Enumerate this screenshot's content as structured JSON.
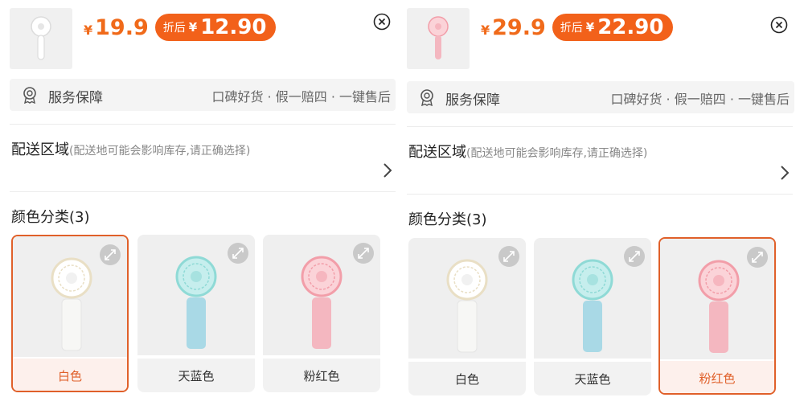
{
  "panels": [
    {
      "price_currency": "¥",
      "original_price": "19.9",
      "discount_label": "折后",
      "discount_currency": "¥",
      "discount_price": "12.90",
      "thumb_color": "#ffffff",
      "service_title": "服务保障",
      "service_tags": "口碑好货 · 假一赔四 · 一键售后",
      "delivery_title": "配送区域",
      "delivery_hint": "(配送地可能会影响库存,请正确选择)",
      "color_section_title": "颜色分类(3)",
      "selected_index": 0,
      "swatches": [
        {
          "name": "白色",
          "color": "#f7f7f5",
          "blade": "#ece4cf"
        },
        {
          "name": "天蓝色",
          "color": "#a9d9e6",
          "blade": "#98e0dc"
        },
        {
          "name": "粉红色",
          "color": "#f4b7c0",
          "blade": "#f6aab3"
        }
      ]
    },
    {
      "price_currency": "¥",
      "original_price": "29.9",
      "discount_label": "折后",
      "discount_currency": "¥",
      "discount_price": "22.90",
      "thumb_color": "#f4b7c0",
      "service_title": "服务保障",
      "service_tags": "口碑好货 · 假一赔四 · 一键售后",
      "delivery_title": "配送区域",
      "delivery_hint": "(配送地可能会影响库存,请正确选择)",
      "color_section_title": "颜色分类(3)",
      "selected_index": 2,
      "swatches": [
        {
          "name": "白色",
          "color": "#f7f7f5",
          "blade": "#ece4cf"
        },
        {
          "name": "天蓝色",
          "color": "#a9d9e6",
          "blade": "#98e0dc"
        },
        {
          "name": "粉红色",
          "color": "#f4b7c0",
          "blade": "#f6aab3"
        }
      ]
    }
  ],
  "accent_color": "#f2611a"
}
